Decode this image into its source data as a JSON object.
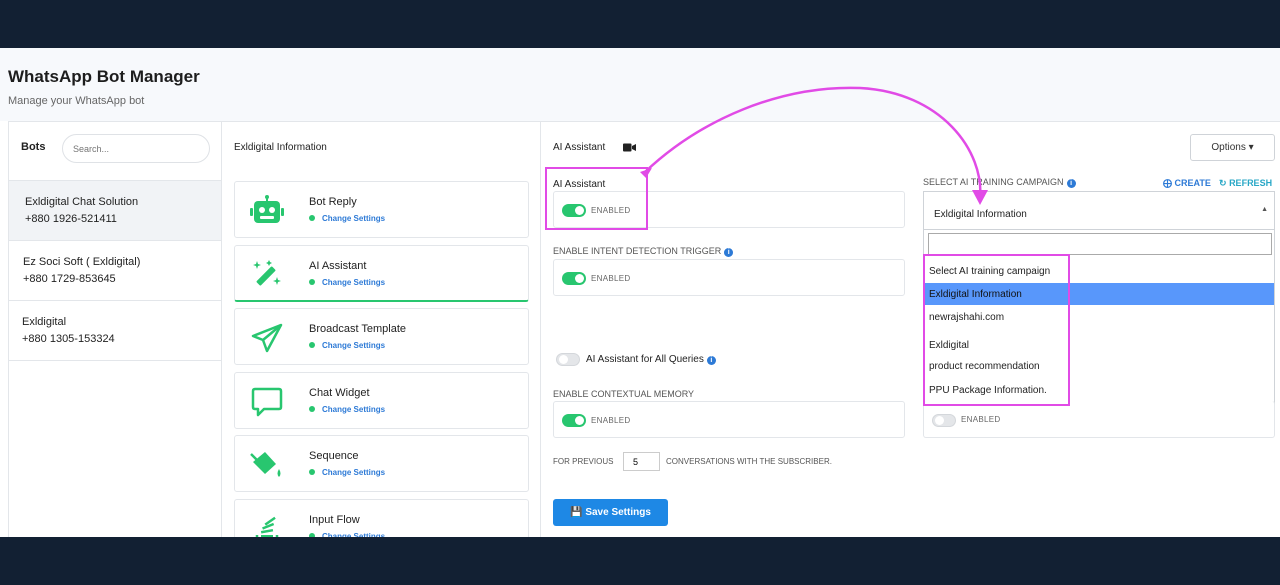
{
  "header": {
    "title": "WhatsApp Bot Manager",
    "subtitle": "Manage your WhatsApp bot"
  },
  "bots": {
    "label": "Bots",
    "search_placeholder": "Search...",
    "items": [
      {
        "name": "Exldigital  Chat Solution",
        "phone": "+880 1926-521411"
      },
      {
        "name": "Ez Soci Soft ( Exldigital)",
        "phone": "+880 1729-853645"
      },
      {
        "name": "Exldigital",
        "phone": "+880 1305-153324"
      }
    ]
  },
  "templates": {
    "title": "Exldigital  Information",
    "link_label": "Change Settings",
    "items": [
      {
        "name": "Bot Reply",
        "icon": "robot-icon"
      },
      {
        "name": "AI Assistant",
        "icon": "magic-wand-icon"
      },
      {
        "name": "Broadcast Template",
        "icon": "paper-plane-icon"
      },
      {
        "name": "Chat Widget",
        "icon": "chat-bubble-icon"
      },
      {
        "name": "Sequence",
        "icon": "paint-bucket-icon"
      },
      {
        "name": "Input Flow",
        "icon": "stack-icon"
      }
    ]
  },
  "main": {
    "title": "AI Assistant",
    "options_label": "Options",
    "ai_assistant_label": "AI Assistant",
    "enabled_label": "ENABLED",
    "intent_label": "ENABLE INTENT DETECTION TRIGGER",
    "all_queries_label": "AI Assistant for All Queries",
    "contextual_label": "ENABLE CONTEXTUAL MEMORY",
    "for_previous_label": "FOR PREVIOUS",
    "previous_value": "5",
    "conversations_label": "CONVERSATIONS WITH THE SUBSCRIBER.",
    "save_label": "Save Settings",
    "campaign_label": "SELECT AI TRAINING CAMPAIGN",
    "create_label": "CREATE",
    "refresh_label": "REFRESH",
    "campaign_selected": "Exldigital  Information",
    "campaign_options": [
      "Select AI training campaign",
      "Exldigital  Information",
      "newrajshahi.com",
      "Exldigital",
      "product recommendation",
      "PPU Package Information."
    ],
    "highlighted_option_index": 1,
    "right_enabled_label": "ENABLED"
  },
  "colors": {
    "accent": "#1e88e5",
    "toggle_on": "#28c66f",
    "annotation": "#e14be6",
    "dropdown_highlight": "#5897fb"
  }
}
